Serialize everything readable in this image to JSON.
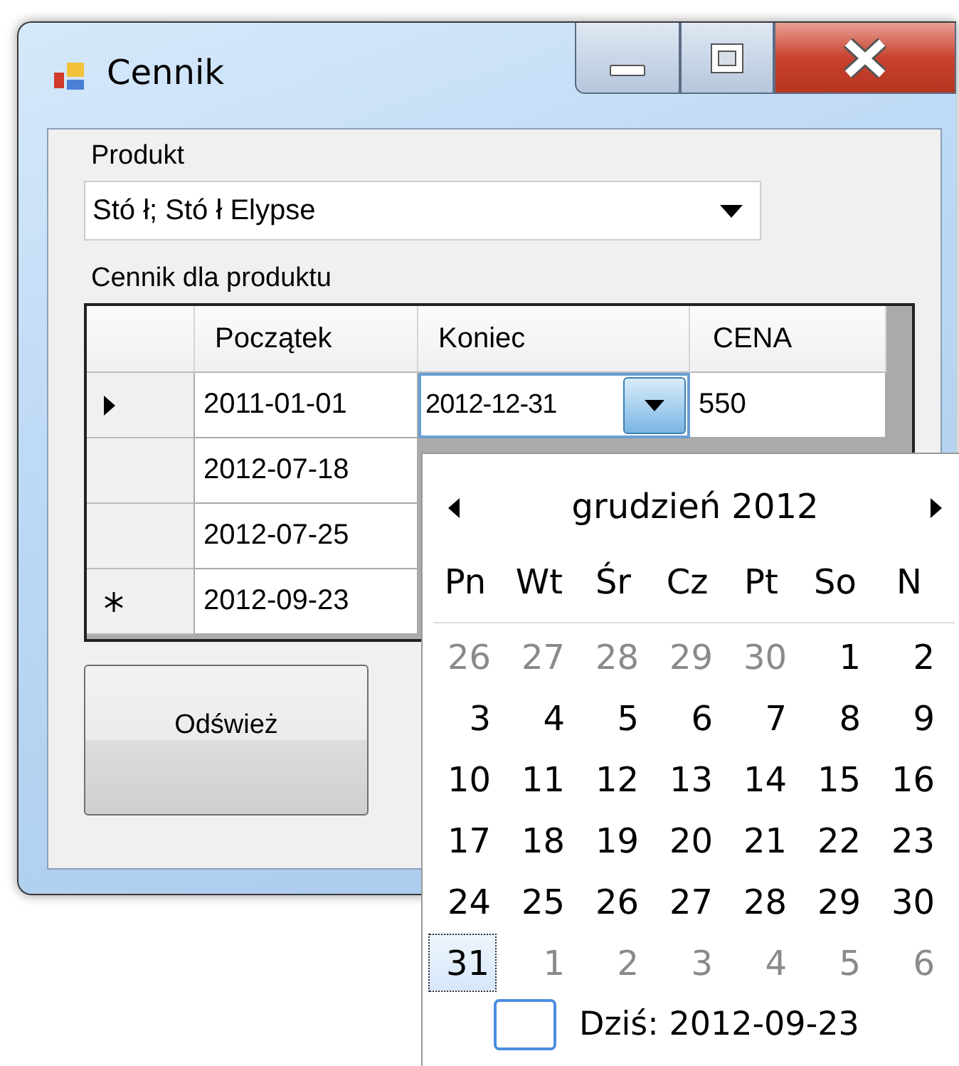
{
  "window": {
    "title": "Cennik"
  },
  "product": {
    "label": "Produkt",
    "value": "Stó ł; Stó ł Elypse"
  },
  "grid_label": "Cennik dla produktu",
  "grid": {
    "columns": [
      "Początek",
      "Koniec",
      "CENA"
    ],
    "rows": [
      {
        "current": true,
        "new_row": false,
        "cells": [
          {
            "kind": "text",
            "text": "2011-01-01"
          },
          {
            "kind": "date_picker",
            "text": "2012-12-31"
          },
          {
            "kind": "text",
            "text": "550"
          }
        ]
      },
      {
        "current": false,
        "new_row": false,
        "cells": [
          {
            "kind": "text",
            "text": "2012-07-18"
          }
        ]
      },
      {
        "current": false,
        "new_row": false,
        "cells": [
          {
            "kind": "text",
            "text": "2012-07-25"
          }
        ]
      },
      {
        "current": false,
        "new_row": true,
        "cells": [
          {
            "kind": "text",
            "text": "2012-09-23"
          }
        ]
      }
    ]
  },
  "refresh_button": "Odśwież",
  "calendar": {
    "month": "grudzień 2012",
    "weekdays": [
      "Pn",
      "Wt",
      "Śr",
      "Cz",
      "Pt",
      "So",
      "N"
    ],
    "weeks": [
      [
        {
          "day": "26",
          "other_month": true,
          "selected": false
        },
        {
          "day": "27",
          "other_month": true,
          "selected": false
        },
        {
          "day": "28",
          "other_month": true,
          "selected": false
        },
        {
          "day": "29",
          "other_month": true,
          "selected": false
        },
        {
          "day": "30",
          "other_month": true,
          "selected": false
        },
        {
          "day": "1",
          "other_month": false,
          "selected": false
        },
        {
          "day": "2",
          "other_month": false,
          "selected": false
        }
      ],
      [
        {
          "day": "3",
          "other_month": false,
          "selected": false
        },
        {
          "day": "4",
          "other_month": false,
          "selected": false
        },
        {
          "day": "5",
          "other_month": false,
          "selected": false
        },
        {
          "day": "6",
          "other_month": false,
          "selected": false
        },
        {
          "day": "7",
          "other_month": false,
          "selected": false
        },
        {
          "day": "8",
          "other_month": false,
          "selected": false
        },
        {
          "day": "9",
          "other_month": false,
          "selected": false
        }
      ],
      [
        {
          "day": "10",
          "other_month": false,
          "selected": false
        },
        {
          "day": "11",
          "other_month": false,
          "selected": false
        },
        {
          "day": "12",
          "other_month": false,
          "selected": false
        },
        {
          "day": "13",
          "other_month": false,
          "selected": false
        },
        {
          "day": "14",
          "other_month": false,
          "selected": false
        },
        {
          "day": "15",
          "other_month": false,
          "selected": false
        },
        {
          "day": "16",
          "other_month": false,
          "selected": false
        }
      ],
      [
        {
          "day": "17",
          "other_month": false,
          "selected": false
        },
        {
          "day": "18",
          "other_month": false,
          "selected": false
        },
        {
          "day": "19",
          "other_month": false,
          "selected": false
        },
        {
          "day": "20",
          "other_month": false,
          "selected": false
        },
        {
          "day": "21",
          "other_month": false,
          "selected": false
        },
        {
          "day": "22",
          "other_month": false,
          "selected": false
        },
        {
          "day": "23",
          "other_month": false,
          "selected": false
        }
      ],
      [
        {
          "day": "24",
          "other_month": false,
          "selected": false
        },
        {
          "day": "25",
          "other_month": false,
          "selected": false
        },
        {
          "day": "26",
          "other_month": false,
          "selected": false
        },
        {
          "day": "27",
          "other_month": false,
          "selected": false
        },
        {
          "day": "28",
          "other_month": false,
          "selected": false
        },
        {
          "day": "29",
          "other_month": false,
          "selected": false
        },
        {
          "day": "30",
          "other_month": false,
          "selected": false
        }
      ],
      [
        {
          "day": "31",
          "other_month": false,
          "selected": true
        },
        {
          "day": "1",
          "other_month": true,
          "selected": false
        },
        {
          "day": "2",
          "other_month": true,
          "selected": false
        },
        {
          "day": "3",
          "other_month": true,
          "selected": false
        },
        {
          "day": "4",
          "other_month": true,
          "selected": false
        },
        {
          "day": "5",
          "other_month": true,
          "selected": false
        },
        {
          "day": "6",
          "other_month": true,
          "selected": false
        }
      ]
    ],
    "today": "Dziś: 2012-09-23"
  }
}
